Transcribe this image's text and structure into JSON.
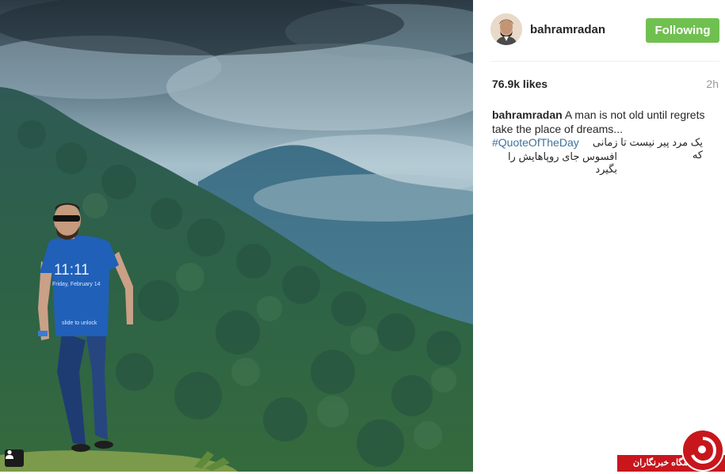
{
  "post": {
    "username": "bahramradan",
    "follow_label": "Following",
    "likes": "76.9k likes",
    "time": "2h",
    "caption_user": "bahramradan",
    "caption_text": " A man is not old until regrets take the place of dreams...",
    "hashtag": "#QuoteOfTheDay",
    "persian_line1": "یک مرد پیر نیست تا زمانی که",
    "persian_line2": "افسوس جای روپاهایش را بگیرد"
  },
  "photo": {
    "shirt_time": "11:11",
    "shirt_date": "Friday, February 14",
    "shirt_slide": "slide to unlock"
  },
  "watermark": {
    "label": "باشگاه خبرنگاران"
  },
  "colors": {
    "follow_button": "#70c050",
    "hashtag": "#3f729b",
    "watermark": "#c8161d"
  },
  "icons": {
    "user_tag": "person-icon",
    "watermark_logo": "news-logo-icon"
  }
}
